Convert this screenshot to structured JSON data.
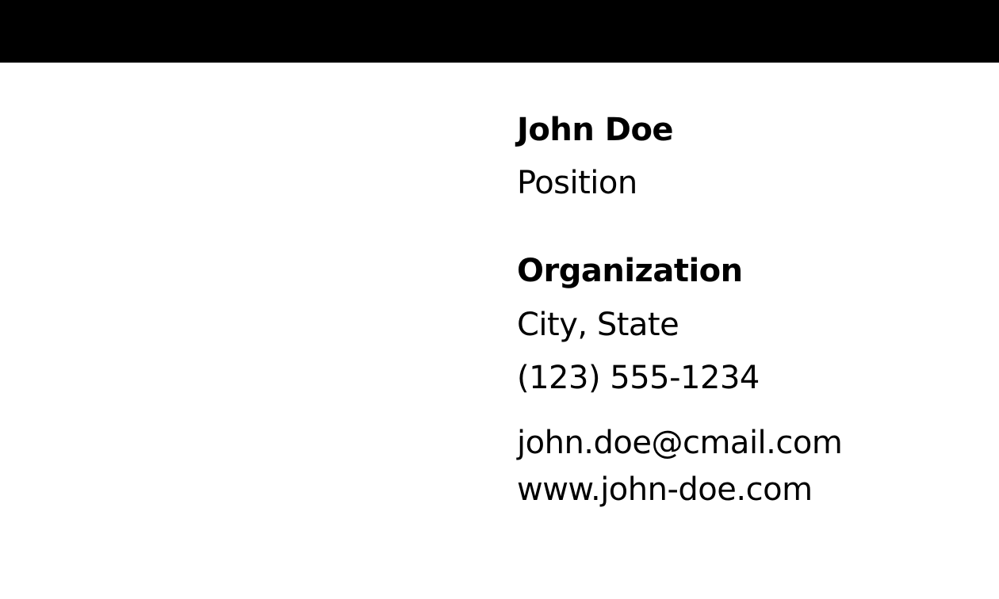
{
  "card": {
    "name": "John Doe",
    "position": "Position",
    "organization": "Organization",
    "location": "City, State",
    "phone": "(123) 555-1234",
    "email": "john.doe@cmail.com",
    "website": "www.john-doe.com"
  },
  "colors": {
    "top_bar": "#000000",
    "background": "#ffffff",
    "text": "#000000"
  }
}
